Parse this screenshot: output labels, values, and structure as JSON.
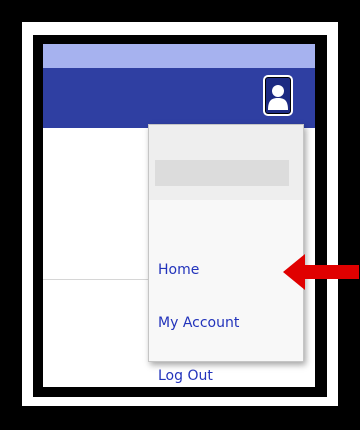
{
  "header": {
    "user_icon": "user-silhouette-icon",
    "accent_color": "#2f3fa2"
  },
  "menu": {
    "items": [
      {
        "label": "Home"
      },
      {
        "label": "My Account"
      },
      {
        "label": "Log Out"
      }
    ]
  },
  "annotation": {
    "arrow_icon": "red-left-arrow",
    "arrow_color": "#e00000"
  }
}
